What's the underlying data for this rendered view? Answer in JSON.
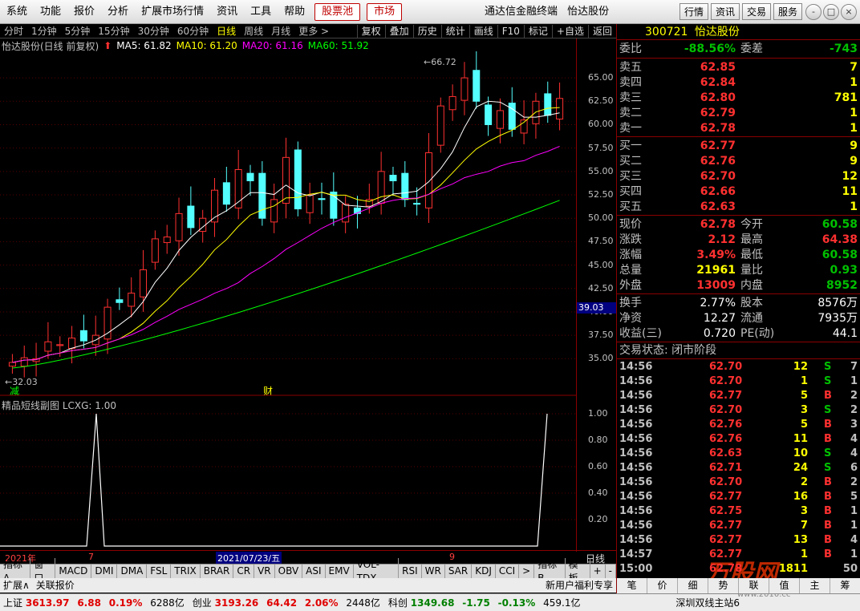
{
  "menu": [
    "系统",
    "功能",
    "报价",
    "分析",
    "扩展市场行情",
    "资讯",
    "工具",
    "帮助"
  ],
  "menu_red": [
    "股票池",
    "市场"
  ],
  "app_title": "通达信金融终端",
  "stock_title": "怡达股份",
  "top_buttons": [
    "行情",
    "资讯",
    "交易",
    "服务"
  ],
  "window_controls": [
    "-",
    "□",
    "×"
  ],
  "periods": [
    "分时",
    "1分钟",
    "5分钟",
    "15分钟",
    "30分钟",
    "60分钟",
    "日线",
    "周线",
    "月线",
    "更多 >"
  ],
  "active_period": "日线",
  "functions": [
    "复权",
    "叠加",
    "历史",
    "统计",
    "画线",
    "F10",
    "标记",
    "+自选",
    "返回"
  ],
  "chart_header": {
    "name": "怡达股份(日线 前复权)",
    "ma5": "MA5: 61.82",
    "ma10": "MA10: 61.20",
    "ma20": "MA20: 61.16",
    "ma60": "MA60: 51.92"
  },
  "main_axis": [
    "65.00",
    "62.50",
    "60.00",
    "57.50",
    "55.00",
    "52.50",
    "50.00",
    "47.50",
    "45.00",
    "42.50",
    "40.00",
    "37.50",
    "35.00"
  ],
  "last_price_tag": "39.03",
  "high_label": "66.72",
  "low_label": "32.03",
  "chart_markers": {
    "reduce": "减",
    "finance": "财"
  },
  "sub_header": "精品短线副图 LCXG: 1.00",
  "sub_axis": [
    "1.00",
    "0.80",
    "0.60",
    "0.40",
    "0.20"
  ],
  "dates": {
    "year": "2021年",
    "m7": "7",
    "cursor": "2021/07/23/五",
    "m9": "9",
    "period": "日线"
  },
  "indicator_tabs": [
    "指标A",
    "窗口",
    "MACD",
    "DMI",
    "DMA",
    "FSL",
    "TRIX",
    "BRAR",
    "CR",
    "VR",
    "OBV",
    "ASI",
    "EMV",
    "VOL-TDX",
    "RSI",
    "WR",
    "SAR",
    "KDJ",
    "CCI",
    ">",
    "指标B",
    "模板",
    "+",
    "-"
  ],
  "tabs2": [
    "扩展∧",
    "关联报价"
  ],
  "tabs2_right": "新用户福利专享",
  "status": {
    "sh_label": "上证",
    "sh_val": "3613.97",
    "sh_chg": "6.88",
    "sh_pct": "0.19%",
    "sh_amt": "6288亿",
    "cy_label": "创业",
    "cy_val": "3193.26",
    "cy_chg": "64.42",
    "cy_pct": "2.06%",
    "cy_amt": "2448亿",
    "kc_label": "科创",
    "kc_val": "1349.68",
    "kc_chg": "-1.75",
    "kc_pct": "-0.13%",
    "kc_amt": "459.1亿",
    "server": "深圳双线主站6"
  },
  "quote": {
    "code": "300721",
    "name": "怡达股份",
    "wb_label": "委比",
    "wb": "-88.56%",
    "wc_label": "委差",
    "wc": "-743",
    "asks": [
      {
        "label": "卖五",
        "price": "62.85",
        "vol": "7"
      },
      {
        "label": "卖四",
        "price": "62.84",
        "vol": "1"
      },
      {
        "label": "卖三",
        "price": "62.80",
        "vol": "781"
      },
      {
        "label": "卖二",
        "price": "62.79",
        "vol": "1"
      },
      {
        "label": "卖一",
        "price": "62.78",
        "vol": "1"
      }
    ],
    "bids": [
      {
        "label": "买一",
        "price": "62.77",
        "vol": "9"
      },
      {
        "label": "买二",
        "price": "62.76",
        "vol": "9"
      },
      {
        "label": "买三",
        "price": "62.70",
        "vol": "12"
      },
      {
        "label": "买四",
        "price": "62.66",
        "vol": "11"
      },
      {
        "label": "买五",
        "price": "62.63",
        "vol": "1"
      }
    ],
    "stats1": [
      {
        "l1": "现价",
        "v1": "62.78",
        "c1": "red",
        "l2": "今开",
        "v2": "60.58",
        "c2": "green"
      },
      {
        "l1": "涨跌",
        "v1": "2.12",
        "c1": "red",
        "l2": "最高",
        "v2": "64.38",
        "c2": "red"
      },
      {
        "l1": "涨幅",
        "v1": "3.49%",
        "c1": "red",
        "l2": "最低",
        "v2": "60.58",
        "c2": "green"
      },
      {
        "l1": "总量",
        "v1": "21961",
        "c1": "yel",
        "l2": "量比",
        "v2": "0.93",
        "c2": "green"
      },
      {
        "l1": "外盘",
        "v1": "13009",
        "c1": "red",
        "l2": "内盘",
        "v2": "8952",
        "c2": "green"
      }
    ],
    "stats2": [
      {
        "l1": "换手",
        "v1": "2.77%",
        "l2": "股本",
        "v2": "8576万"
      },
      {
        "l1": "净资",
        "v1": "12.27",
        "l2": "流通",
        "v2": "7935万"
      },
      {
        "l1": "收益(三)",
        "v1": "0.720",
        "l2": "PE(动)",
        "v2": "44.1"
      }
    ],
    "trade_state": "交易状态: 闭市阶段",
    "ticks": [
      {
        "t": "14:56",
        "p": "62.70",
        "v": "12",
        "bs": "S",
        "n": "7"
      },
      {
        "t": "14:56",
        "p": "62.70",
        "v": "1",
        "bs": "S",
        "n": "1"
      },
      {
        "t": "14:56",
        "p": "62.77",
        "v": "5",
        "bs": "B",
        "n": "2"
      },
      {
        "t": "14:56",
        "p": "62.70",
        "v": "3",
        "bs": "S",
        "n": "2"
      },
      {
        "t": "14:56",
        "p": "62.76",
        "v": "5",
        "bs": "B",
        "n": "3"
      },
      {
        "t": "14:56",
        "p": "62.76",
        "v": "11",
        "bs": "B",
        "n": "4"
      },
      {
        "t": "14:56",
        "p": "62.63",
        "v": "10",
        "bs": "S",
        "n": "4"
      },
      {
        "t": "14:56",
        "p": "62.71",
        "v": "24",
        "bs": "S",
        "n": "6"
      },
      {
        "t": "14:56",
        "p": "62.70",
        "v": "2",
        "bs": "B",
        "n": "2"
      },
      {
        "t": "14:56",
        "p": "62.77",
        "v": "16",
        "bs": "B",
        "n": "5"
      },
      {
        "t": "14:56",
        "p": "62.75",
        "v": "3",
        "bs": "B",
        "n": "1"
      },
      {
        "t": "14:56",
        "p": "62.77",
        "v": "7",
        "bs": "B",
        "n": "1"
      },
      {
        "t": "14:56",
        "p": "62.77",
        "v": "13",
        "bs": "B",
        "n": "4"
      },
      {
        "t": "14:57",
        "p": "62.77",
        "v": "1",
        "bs": "B",
        "n": "1"
      },
      {
        "t": "15:00",
        "p": "62.78",
        "v": "1811",
        "bs": "",
        "n": "50"
      }
    ],
    "bottom_tabs": [
      "笔",
      "价",
      "细",
      "势",
      "联",
      "值",
      "主",
      "筹"
    ]
  },
  "watermark": {
    "logo": "万股网",
    "url": "www.2010.cc"
  },
  "colors": {
    "up": "#ff3030",
    "down": "#54ffff",
    "ma5": "#ffffff",
    "ma10": "#ffff00",
    "ma20": "#ff00ff",
    "ma60": "#00ff00"
  },
  "chart_data": {
    "type": "line",
    "title": "怡达股份(日线 前复权)",
    "ylim": [
      32.03,
      66.72
    ],
    "candles_close_approx": [
      34.6,
      35.1,
      35.0,
      36.8,
      36.5,
      37.2,
      36.9,
      37.5,
      40.5,
      41.0,
      42.0,
      44.5,
      47.8,
      48.0,
      50.5,
      49.0,
      50.0,
      53.0,
      51.5,
      55.2,
      54.0,
      50.0,
      52.0,
      56.5,
      51.0,
      52.5,
      52.0,
      50.0,
      51.5,
      50.5,
      52.0,
      55.0,
      54.0,
      52.0,
      51.5,
      57.0,
      62.0,
      63.0,
      65.0,
      62.5,
      60.0,
      61.5,
      59.5,
      60.5,
      62.5,
      61.0,
      62.8
    ]
  }
}
